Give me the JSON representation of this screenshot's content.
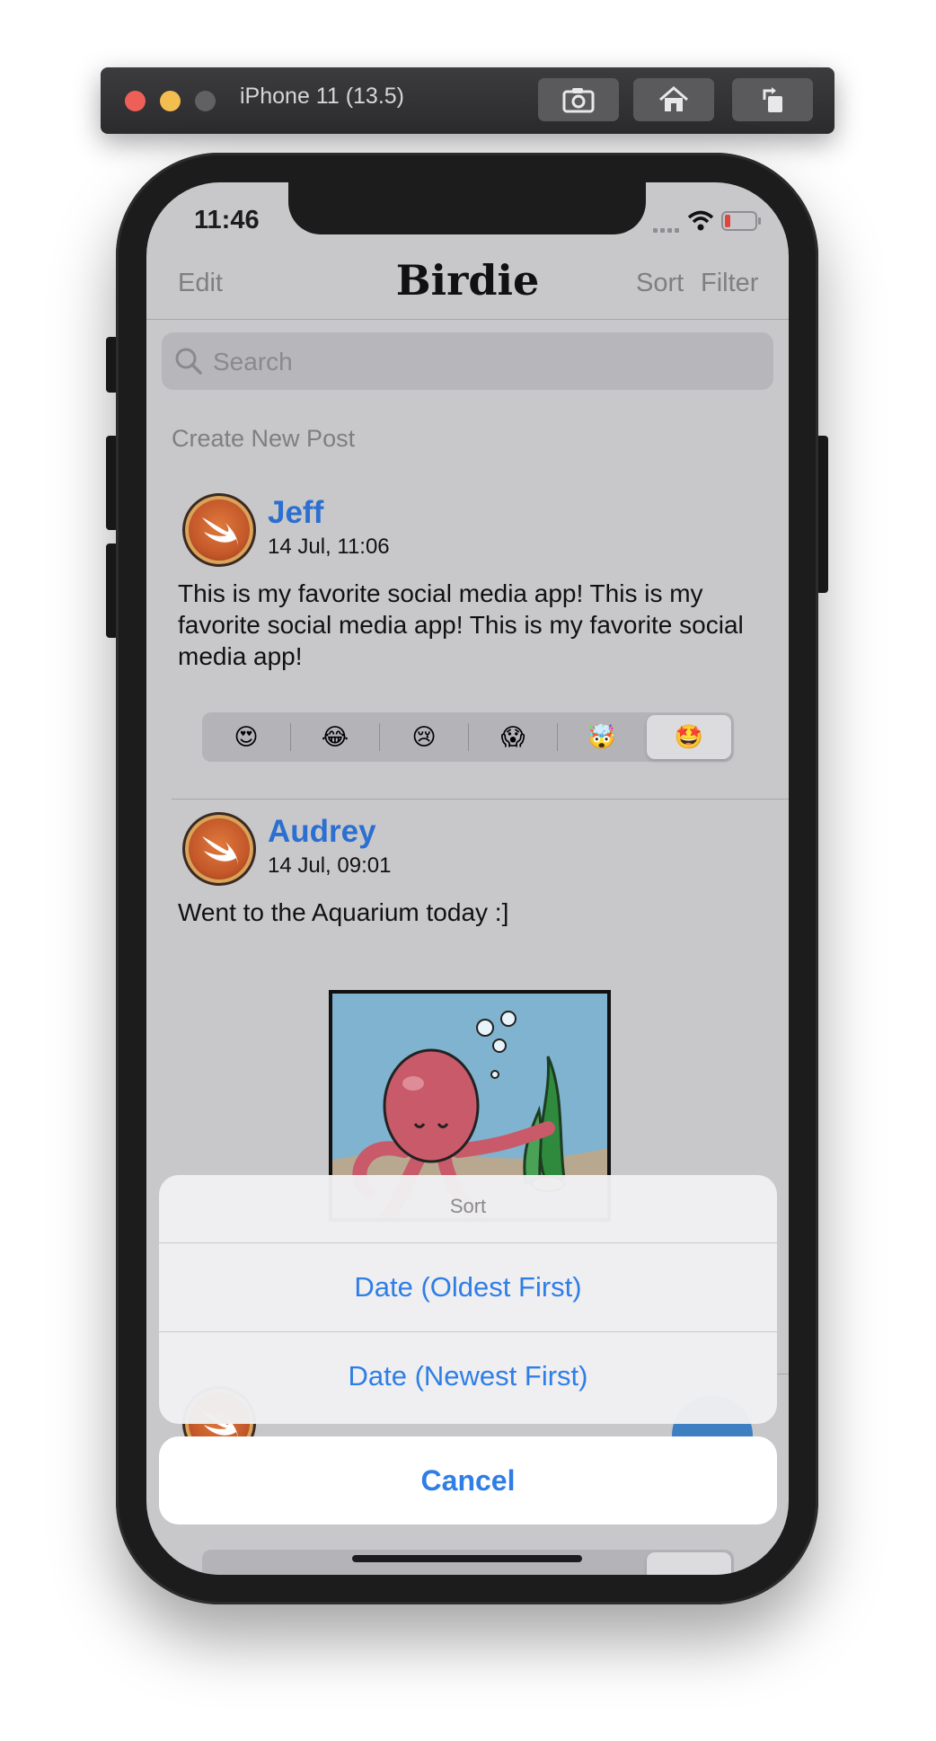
{
  "simulator": {
    "title": "iPhone 11 (13.5)",
    "buttons": [
      "screenshot-icon",
      "home-icon",
      "rotate-icon"
    ]
  },
  "status_bar": {
    "time": "11:46"
  },
  "nav": {
    "edit_label": "Edit",
    "title": "Birdie",
    "sort_label": "Sort",
    "filter_label": "Filter"
  },
  "search": {
    "placeholder": "Search"
  },
  "create_post_label": "Create New Post",
  "posts": [
    {
      "name": "Jeff",
      "date": "14 Jul, 11:06",
      "text": "This is my favorite social media app! This is my favorite social media app! This is my favorite social media app!",
      "reactions": [
        "😍",
        "😂",
        "😢",
        "😱",
        "🤯",
        "🤩"
      ],
      "selected_reaction": 5
    },
    {
      "name": "Audrey",
      "date": "14 Jul, 09:01",
      "text": "Went to the Aquarium today :]",
      "has_image": true
    }
  ],
  "action_sheet": {
    "title": "Sort",
    "options": [
      "Date (Oldest First)",
      "Date (Newest First)"
    ],
    "cancel_label": "Cancel"
  },
  "colors": {
    "accent": "#2f7ee6",
    "name_blue": "#2b6fd0",
    "dimmed_background": "#c8c8ca"
  }
}
